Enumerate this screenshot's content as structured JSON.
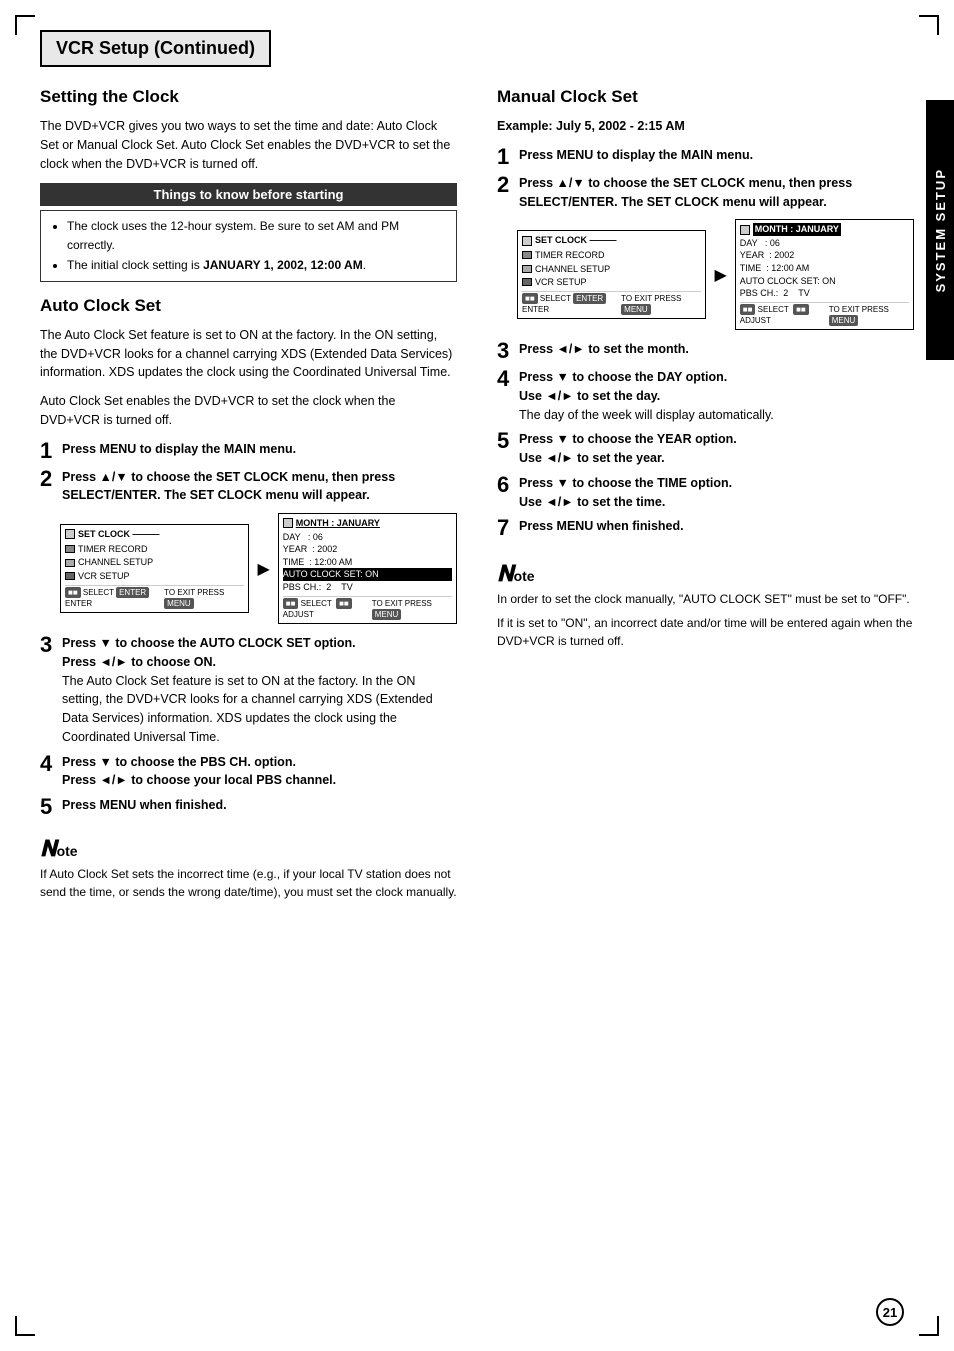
{
  "page": {
    "title": "VCR Setup (Continued)",
    "side_tab": "SYSTEM SETUP",
    "page_number": "21"
  },
  "left_col": {
    "section1": {
      "heading": "Setting the Clock",
      "body1": "The DVD+VCR gives you two ways to set the time and date: Auto Clock Set or Manual Clock Set. Auto Clock Set enables the DVD+VCR to set the clock when the DVD+VCR is turned off.",
      "know_box_title": "Things to know before starting",
      "know_items": [
        "The clock uses the 12-hour system. Be sure to set AM and PM correctly.",
        "The initial clock setting is JANUARY 1, 2002, 12:00 AM."
      ]
    },
    "section2": {
      "heading": "Auto Clock Set",
      "body1": "The Auto Clock Set feature is set to ON at the factory. In the ON setting, the DVD+VCR looks for a channel carrying XDS (Extended Data Services) information. XDS updates the clock using the Coordinated Universal Time.",
      "body2": "Auto Clock Set enables the DVD+VCR to set the clock when the DVD+VCR is turned off.",
      "steps": [
        {
          "num": "1",
          "text": "Press MENU to display the MAIN menu."
        },
        {
          "num": "2",
          "text": "Press ▲/▼ to choose the SET CLOCK menu, then press SELECT/ENTER. The SET CLOCK menu will appear."
        },
        {
          "num": "3",
          "text": "Press ▼ to choose the AUTO CLOCK SET option.",
          "sub": "Press ◄/► to choose ON.",
          "sub_body": "The Auto Clock Set feature is set to ON at the factory. In the ON setting, the DVD+VCR looks for a channel carrying XDS (Extended Data Services) information. XDS updates the clock using the Coordinated Universal Time."
        },
        {
          "num": "4",
          "text": "Press ▼ to choose the PBS CH. option.",
          "sub": "Press ◄/► to choose your local PBS channel."
        },
        {
          "num": "5",
          "text": "Press MENU when finished."
        }
      ],
      "note": {
        "text": "If Auto Clock Set sets the incorrect time (e.g., if your local TV station does not send the time, or sends the wrong date/time), you must set the clock manually."
      }
    }
  },
  "right_col": {
    "section": {
      "heading": "Manual Clock Set",
      "example": "Example: July 5, 2002 - 2:15 AM",
      "steps": [
        {
          "num": "1",
          "text": "Press MENU to display the MAIN menu."
        },
        {
          "num": "2",
          "text": "Press ▲/▼ to choose the SET CLOCK menu, then press SELECT/ENTER. The SET CLOCK menu will appear."
        },
        {
          "num": "3",
          "text": "Press ◄/► to set the month."
        },
        {
          "num": "4",
          "text": "Press ▼ to choose the DAY option.",
          "sub": "Use ◄/► to set the day.",
          "sub_body": "The day of the week will display automatically."
        },
        {
          "num": "5",
          "text": "Press ▼ to choose the YEAR option.",
          "sub": "Use ◄/► to set the year."
        },
        {
          "num": "6",
          "text": "Press ▼ to choose the TIME option.",
          "sub": "Use ◄/► to set the time."
        },
        {
          "num": "7",
          "text": "Press MENU when finished."
        }
      ],
      "note": {
        "line1": "In order to set the clock manually, \"AUTO CLOCK SET\" must be set to \"OFF\".",
        "line2": "If it is set to \"ON\", an incorrect date and/or time will be entered again when the DVD+VCR is turned off."
      }
    }
  },
  "screen_left": {
    "menu_items": [
      "SET CLOCK",
      "TIMER RECORD",
      "CHANNEL SETUP",
      "VCR SETUP"
    ],
    "bottom_left": "SELECT  ENTER  ENTER",
    "bottom_right": "TO EXIT  PRESS"
  },
  "screen_right_auto": {
    "lines": [
      "MONTH  :  JANUARY",
      "DAY    :  06",
      "YEAR   :  2002",
      "TIME   :  12:00 AM",
      "AUTO CLOCK SET: ON",
      "PBS CH.:  2     TV"
    ],
    "bottom_left": "SELECT      ADJUST",
    "bottom_right": "TO EXIT  PRESS"
  },
  "screen_right_manual": {
    "lines": [
      "MONTH  :  JANUARY",
      "DAY    :  06",
      "YEAR   :  2002",
      "TIME   :  12:00 AM",
      "AUTO CLOCK SET: ON",
      "PBS CH.:  2     TV"
    ],
    "bottom_left": "SELECT      ADJUST",
    "bottom_right": "TO EXIT  PRESS"
  }
}
